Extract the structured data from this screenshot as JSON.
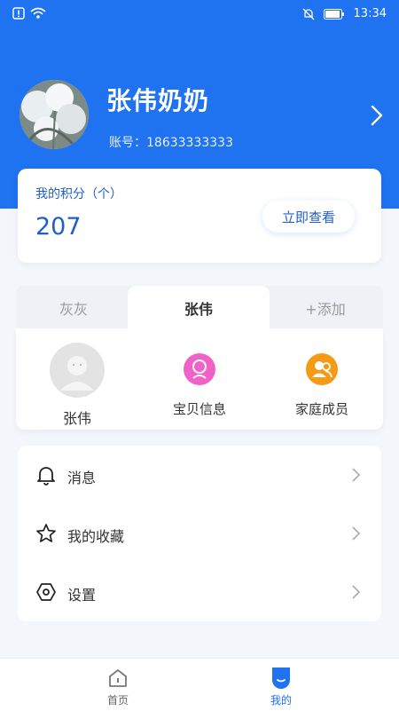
{
  "status_bar": {
    "time": "13:34"
  },
  "profile": {
    "name": "张伟奶奶",
    "account": "账号：18633333333"
  },
  "points": {
    "label": "我的积分（个）",
    "value": "207",
    "button": "立即查看"
  },
  "family_tabs": [
    {
      "label": "灰灰",
      "active": false
    },
    {
      "label": "张伟",
      "active": true
    },
    {
      "label": "+添加",
      "active": false
    }
  ],
  "family_items": [
    {
      "label": "张伟",
      "icon": "default-avatar-icon"
    },
    {
      "label": "宝贝信息",
      "icon": "baby-info-icon",
      "color": "#f062c8"
    },
    {
      "label": "家庭成员",
      "icon": "family-members-icon",
      "color": "#f59a14"
    }
  ],
  "menu": [
    {
      "label": "消息",
      "icon": "bell-icon"
    },
    {
      "label": "我的收藏",
      "icon": "star-icon"
    },
    {
      "label": "设置",
      "icon": "settings-icon"
    }
  ],
  "bottom_nav": [
    {
      "label": "首页",
      "icon": "home-icon",
      "active": false
    },
    {
      "label": "我的",
      "icon": "profile-icon",
      "active": true
    }
  ],
  "colors": {
    "brand_blue": "#1f72f0",
    "text_blue": "#1f5fc8"
  }
}
